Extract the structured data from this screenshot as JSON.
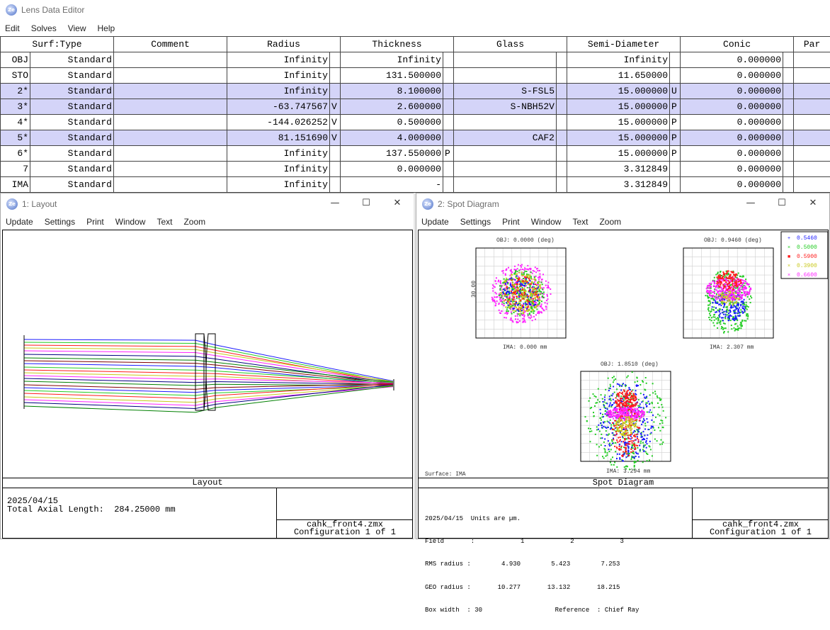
{
  "editor": {
    "title": "Lens Data Editor",
    "menu": [
      "Edit",
      "Solves",
      "View",
      "Help"
    ],
    "columns": [
      "Surf:Type",
      "Comment",
      "Radius",
      "Thickness",
      "Glass",
      "Semi-Diameter",
      "Conic",
      "Par"
    ],
    "rows": [
      {
        "surf": "OBJ",
        "type": "Standard",
        "radius": "Infinity",
        "rflag": "",
        "thick": "Infinity",
        "tflag": "",
        "glass": "",
        "gflag": "",
        "semi": "Infinity",
        "sflag": "",
        "conic": "0.000000",
        "hl": false
      },
      {
        "surf": "STO",
        "type": "Standard",
        "radius": "Infinity",
        "rflag": "",
        "thick": "131.500000",
        "tflag": "",
        "glass": "",
        "gflag": "",
        "semi": "11.650000",
        "sflag": "",
        "conic": "0.000000",
        "hl": false
      },
      {
        "surf": "2*",
        "type": "Standard",
        "radius": "Infinity",
        "rflag": "",
        "thick": "8.100000",
        "tflag": "",
        "glass": "S-FSL5",
        "gflag": "",
        "semi": "15.000000",
        "sflag": "U",
        "conic": "0.000000",
        "hl": true
      },
      {
        "surf": "3*",
        "type": "Standard",
        "radius": "-63.747567",
        "rflag": "V",
        "thick": "2.600000",
        "tflag": "",
        "glass": "S-NBH52V",
        "gflag": "",
        "semi": "15.000000",
        "sflag": "P",
        "conic": "0.000000",
        "hl": true
      },
      {
        "surf": "4*",
        "type": "Standard",
        "radius": "-144.026252",
        "rflag": "V",
        "thick": "0.500000",
        "tflag": "",
        "glass": "",
        "gflag": "",
        "semi": "15.000000",
        "sflag": "P",
        "conic": "0.000000",
        "hl": false
      },
      {
        "surf": "5*",
        "type": "Standard",
        "radius": "81.151690",
        "rflag": "V",
        "thick": "4.000000",
        "tflag": "",
        "glass": "CAF2",
        "gflag": "",
        "semi": "15.000000",
        "sflag": "P",
        "conic": "0.000000",
        "hl": true
      },
      {
        "surf": "6*",
        "type": "Standard",
        "radius": "Infinity",
        "rflag": "",
        "thick": "137.550000",
        "tflag": "P",
        "glass": "",
        "gflag": "",
        "semi": "15.000000",
        "sflag": "P",
        "conic": "0.000000",
        "hl": false
      },
      {
        "surf": "7",
        "type": "Standard",
        "radius": "Infinity",
        "rflag": "",
        "thick": "0.000000",
        "tflag": "",
        "glass": "",
        "gflag": "",
        "semi": "3.312849",
        "sflag": "",
        "conic": "0.000000",
        "hl": false
      },
      {
        "surf": "IMA",
        "type": "Standard",
        "radius": "Infinity",
        "rflag": "",
        "thick": "-",
        "tflag": "",
        "glass": "",
        "gflag": "",
        "semi": "3.312849",
        "sflag": "",
        "conic": "0.000000",
        "hl": false
      }
    ]
  },
  "layout": {
    "title": "1: Layout",
    "menu": [
      "Update",
      "Settings",
      "Print",
      "Window",
      "Text",
      "Zoom"
    ],
    "caption": "Layout",
    "date": "2025/04/15",
    "length": "Total Axial Length:  284.25000 mm",
    "file": "cahk_front4.zmx",
    "config": "Configuration 1 of 1"
  },
  "spot": {
    "title": "2: Spot Diagram",
    "menu": [
      "Update",
      "Settings",
      "Print",
      "Window",
      "Text",
      "Zoom"
    ],
    "caption": "Spot Diagram",
    "file": "cahk_front4.zmx",
    "config": "Configuration 1 of 1",
    "fields": [
      {
        "obj": "OBJ: 0.0000 (deg)",
        "ima": "IMA: 0.000 mm"
      },
      {
        "obj": "OBJ: 0.9460 (deg)",
        "ima": "IMA: 2.307 mm"
      },
      {
        "obj": "OBJ: 1.8510 (deg)",
        "ima": "IMA: 3.294 mm"
      }
    ],
    "scale": "30.00",
    "surface": "Surface: IMA",
    "legend": [
      {
        "w": "0.5460",
        "c": "#1a1aff",
        "m": "+"
      },
      {
        "w": "0.5000",
        "c": "#22cc22",
        "m": "×"
      },
      {
        "w": "0.5900",
        "c": "#ff1a1a",
        "m": "■"
      },
      {
        "w": "0.3900",
        "c": "#c8c81a",
        "m": "×"
      },
      {
        "w": "0.6600",
        "c": "#ff22ff",
        "m": "×"
      }
    ],
    "info": [
      "2025/04/15  Units are µm.",
      "Field       :            1            2            3",
      "RMS radius :        4.930        5.423        7.253",
      "GEO radius :       10.277       13.132       18.215",
      "Box width  : 30                   Reference  : Chief Ray"
    ]
  },
  "colors": {
    "highlight": "#d4d4f8",
    "border": "#444444"
  }
}
